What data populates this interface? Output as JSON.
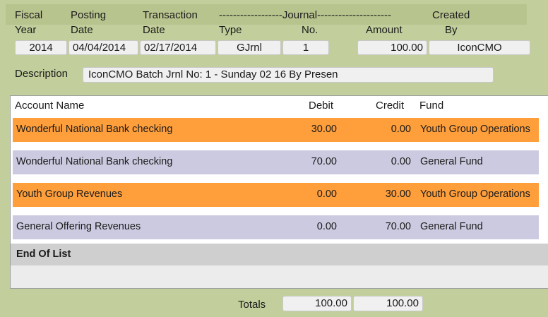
{
  "header": {
    "labels": {
      "fiscal": "Fiscal",
      "year": "Year",
      "posting": "Posting",
      "posting_date": "Date",
      "transaction": "Transaction",
      "transaction_date": "Date",
      "journal": "------------------Journal---------------------",
      "type": "Type",
      "no": "No.",
      "amount": "Amount",
      "created": "Created",
      "by": "By"
    },
    "values": {
      "fiscal_year": "2014",
      "posting_date": "04/04/2014",
      "transaction_date": "02/17/2014",
      "journal_type": "GJrnl",
      "journal_no": "1",
      "amount": "100.00",
      "created_by": "IconCMO"
    },
    "description_label": "Description",
    "description_value": "IconCMO Batch Jrnl No: 1 - Sunday 02 16 By Presen"
  },
  "grid": {
    "columns": {
      "account": "Account Name",
      "debit": "Debit",
      "credit": "Credit",
      "fund": "Fund"
    },
    "rows": [
      {
        "account": "Wonderful National Bank checking",
        "debit": "30.00",
        "credit": "0.00",
        "fund": "Youth Group Operations",
        "color": "#ff9f3c"
      },
      {
        "account": "Wonderful National Bank checking",
        "debit": "70.00",
        "credit": "0.00",
        "fund": "General Fund",
        "color": "#cccae0"
      },
      {
        "account": "Youth Group Revenues",
        "debit": "0.00",
        "credit": "30.00",
        "fund": "Youth Group Operations",
        "color": "#ff9f3c"
      },
      {
        "account": "General Offering Revenues",
        "debit": "0.00",
        "credit": "70.00",
        "fund": "General Fund",
        "color": "#cccae0"
      }
    ],
    "end_of_list": "End Of List"
  },
  "totals": {
    "label": "Totals",
    "debit": "100.00",
    "credit": "100.00"
  }
}
